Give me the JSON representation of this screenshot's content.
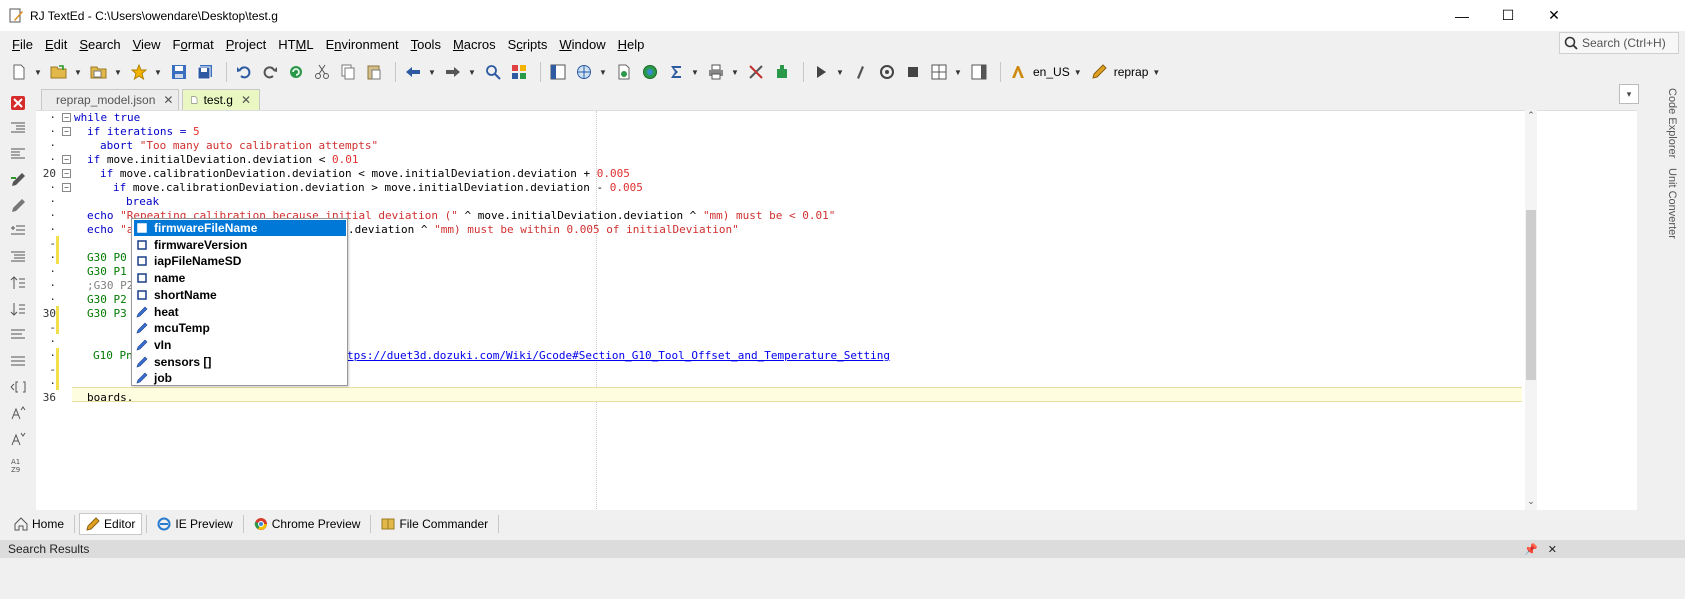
{
  "window": {
    "title": "RJ TextEd - C:\\Users\\owendare\\Desktop\\test.g",
    "minimize_glyph": "—",
    "maximize_glyph": "☐",
    "close_glyph": "✕"
  },
  "menu": [
    {
      "key": "file",
      "pre": "",
      "acc": "F",
      "post": "ile"
    },
    {
      "key": "edit",
      "pre": "",
      "acc": "E",
      "post": "dit"
    },
    {
      "key": "search",
      "pre": "",
      "acc": "S",
      "post": "earch"
    },
    {
      "key": "view",
      "pre": "",
      "acc": "V",
      "post": "iew"
    },
    {
      "key": "format",
      "pre": "F",
      "acc": "o",
      "post": "rmat"
    },
    {
      "key": "project",
      "pre": "",
      "acc": "P",
      "post": "roject"
    },
    {
      "key": "html",
      "pre": "HT",
      "acc": "M",
      "post": "L"
    },
    {
      "key": "environment",
      "pre": "E",
      "acc": "n",
      "post": "vironment"
    },
    {
      "key": "tools",
      "pre": "",
      "acc": "T",
      "post": "ools"
    },
    {
      "key": "macros",
      "pre": "",
      "acc": "M",
      "post": "acros"
    },
    {
      "key": "scripts",
      "pre": "S",
      "acc": "c",
      "post": "ripts"
    },
    {
      "key": "window",
      "pre": "",
      "acc": "W",
      "post": "indow"
    },
    {
      "key": "help",
      "pre": "",
      "acc": "H",
      "post": "elp"
    }
  ],
  "search": {
    "placeholder": "Search (Ctrl+H)"
  },
  "toolbar": {
    "language": "en_US",
    "syntax": "reprap"
  },
  "tabs": [
    {
      "label": "reprap_model.json",
      "close": "✕",
      "active": false
    },
    {
      "label": "test.g",
      "close": "✕",
      "active": true
    }
  ],
  "tab_dropdown": "▾",
  "right_panel": {
    "code_explorer": "Code Explorer",
    "unit_converter": "Unit Converter"
  },
  "gutter": {
    "line_numbers": [
      {
        "label": "·"
      },
      {
        "label": "·"
      },
      {
        "label": "·"
      },
      {
        "label": "·"
      },
      {
        "label": "20"
      },
      {
        "label": "·"
      },
      {
        "label": "·"
      },
      {
        "label": "·"
      },
      {
        "label": "·"
      },
      {
        "label": "-"
      },
      {
        "label": "·"
      },
      {
        "label": "·"
      },
      {
        "label": "·"
      },
      {
        "label": "·"
      },
      {
        "label": "30"
      },
      {
        "label": "-"
      },
      {
        "label": "·"
      },
      {
        "label": "·"
      },
      {
        "label": "-"
      },
      {
        "label": "·"
      },
      {
        "label": "36"
      }
    ],
    "fold_minus": "−"
  },
  "code": {
    "l1_kw": "while",
    "l1_val": "true",
    "l2_kw": "if",
    "l2_var": "iterations =",
    "l2_num": "5",
    "l3_kw": "abort",
    "l3_str": "\"Too many auto calibration attempts\"",
    "l4_kw": "if",
    "l4_expr": "move.initialDeviation.deviation <",
    "l4_num": "0.01",
    "l5_kw": "if",
    "l5_expr": "move.calibrationDeviation.deviation < move.initialDeviation.deviation +",
    "l5_num": "0.005",
    "l6_kw": "if",
    "l6_expr": "move.calibrationDeviation.deviation > move.initialDeviation.deviation -",
    "l6_num": "0.005",
    "l7_kw": "break",
    "l8_kw": "echo",
    "l8_str1": "\"Repeating calibration because initial deviation (\"",
    "l8_mid": "^ move.initialDeviation.deviation ^",
    "l8_str2": "\"mm) must be < 0.01\"",
    "l9_kw": "echo",
    "l9_a": "\"a",
    "l9_mid": ".deviation ^",
    "l9_str2": "\"mm) must be within 0.005 of initialDeviation\"",
    "l10_g": "G30 P0",
    "l11_g": "G30 P1",
    "l12_c": ";G30 P2",
    "l13_g": "G30 P2",
    "l14_g": "G30 P3",
    "l15_g": "G10 Pn",
    "l15_link": "tps://duet3d.dozuki.com/Wiki/Gcode#Section_G10_Tool_Offset_and_Temperature_Setting",
    "l16": "boards."
  },
  "autocomplete": [
    {
      "label": "firmwareFileName",
      "icon": "square",
      "selected": true
    },
    {
      "label": "firmwareVersion",
      "icon": "square",
      "selected": false
    },
    {
      "label": "iapFileNameSD",
      "icon": "square",
      "selected": false
    },
    {
      "label": "name",
      "icon": "square",
      "selected": false
    },
    {
      "label": "shortName",
      "icon": "square",
      "selected": false
    },
    {
      "label": "heat",
      "icon": "pencil",
      "selected": false
    },
    {
      "label": "mcuTemp",
      "icon": "pencil",
      "selected": false
    },
    {
      "label": "vIn",
      "icon": "pencil",
      "selected": false
    },
    {
      "label": "sensors []",
      "icon": "pencil",
      "selected": false
    },
    {
      "label": "job",
      "icon": "pencil",
      "selected": false
    }
  ],
  "bottom_tabs": [
    {
      "label": "Home",
      "active": false
    },
    {
      "label": "Editor",
      "active": true
    },
    {
      "label": "IE Preview",
      "active": false
    },
    {
      "label": "Chrome Preview",
      "active": false
    },
    {
      "label": "File Commander",
      "active": false
    }
  ],
  "search_results": {
    "title": "Search Results",
    "pin": "📌",
    "close": "✕"
  },
  "colors": {
    "accent": "#0078d7",
    "active_tab": "#eaf7c2",
    "current_line": "#fffde0",
    "change_bar": "#f2e04a"
  }
}
